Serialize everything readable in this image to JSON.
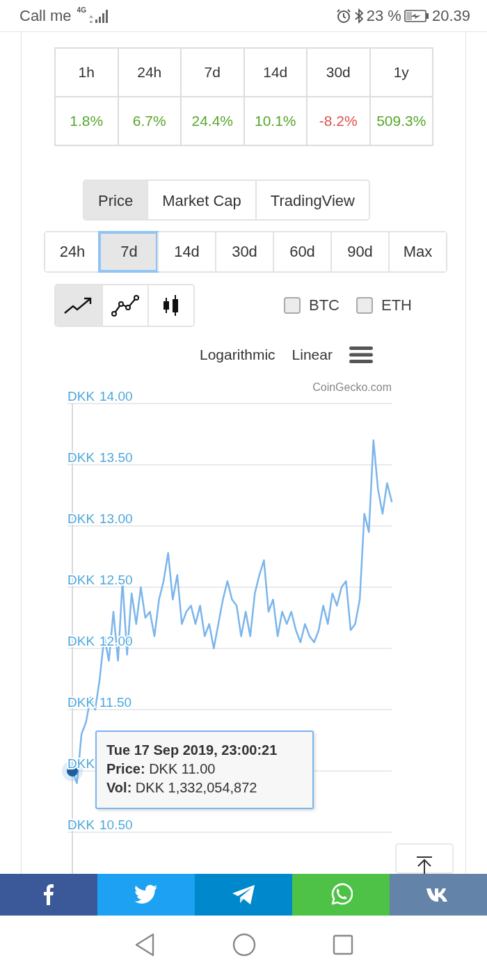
{
  "status_bar": {
    "carrier": "Call me",
    "network": "4G",
    "battery": "23 %",
    "time": "20.39"
  },
  "change_table": {
    "columns": [
      "1h",
      "24h",
      "7d",
      "14d",
      "30d",
      "1y"
    ],
    "values": [
      {
        "text": "1.8%",
        "color": "#58a62b"
      },
      {
        "text": "6.7%",
        "color": "#58a62b"
      },
      {
        "text": "24.4%",
        "color": "#58a62b"
      },
      {
        "text": "10.1%",
        "color": "#58a62b"
      },
      {
        "text": "-8.2%",
        "color": "#d9534f"
      },
      {
        "text": "509.3%",
        "color": "#58a62b"
      }
    ]
  },
  "chart_tabs": [
    {
      "label": "Price",
      "selected": true
    },
    {
      "label": "Market Cap",
      "selected": false
    },
    {
      "label": "TradingView",
      "selected": false
    }
  ],
  "ranges": [
    {
      "label": "24h",
      "selected": false
    },
    {
      "label": "7d",
      "selected": true
    },
    {
      "label": "14d",
      "selected": false
    },
    {
      "label": "30d",
      "selected": false
    },
    {
      "label": "60d",
      "selected": false
    },
    {
      "label": "90d",
      "selected": false
    },
    {
      "label": "Max",
      "selected": false
    }
  ],
  "chart_types": [
    {
      "kind": "line",
      "selected": true
    },
    {
      "kind": "markers",
      "selected": false
    },
    {
      "kind": "candle",
      "selected": false
    }
  ],
  "compare": [
    {
      "label": "BTC",
      "checked": false
    },
    {
      "label": "ETH",
      "checked": false
    }
  ],
  "scales": [
    "Logarithmic",
    "Linear"
  ],
  "chart": {
    "credit": "CoinGecko.com",
    "chart_data": {
      "type": "line",
      "ylabel": "DKK",
      "ylim": [
        10.16,
        14
      ],
      "grid": true,
      "yticks": [
        {
          "value": 14,
          "label": "14.00"
        },
        {
          "value": 13.5,
          "label": "13.50"
        },
        {
          "value": 13,
          "label": "13.00"
        },
        {
          "value": 12.5,
          "label": "12.50"
        },
        {
          "value": 12,
          "label": "12.00"
        },
        {
          "value": 11.5,
          "label": "11.50"
        },
        {
          "value": 10.5,
          "label": "10.50"
        }
      ],
      "series": [
        {
          "color": "#7cb5ec",
          "values": [
            11.0,
            10.9,
            11.3,
            11.4,
            11.6,
            11.5,
            11.75,
            12.1,
            11.9,
            12.3,
            11.9,
            12.55,
            11.95,
            12.45,
            12.2,
            12.5,
            12.25,
            12.3,
            12.1,
            12.4,
            12.55,
            12.78,
            12.4,
            12.6,
            12.2,
            12.3,
            12.35,
            12.2,
            12.35,
            12.1,
            12.2,
            12.0,
            12.2,
            12.4,
            12.55,
            12.4,
            12.35,
            12.1,
            12.3,
            12.1,
            12.45,
            12.6,
            12.72,
            12.3,
            12.4,
            12.1,
            12.3,
            12.2,
            12.3,
            12.15,
            12.05,
            12.2,
            12.1,
            12.05,
            12.15,
            12.35,
            12.2,
            12.45,
            12.35,
            12.5,
            12.55,
            12.15,
            12.2,
            12.4,
            13.1,
            12.95,
            13.7,
            13.3,
            13.1,
            13.35,
            13.2
          ]
        }
      ]
    },
    "tooltip": [
      "Tue 17 Sep 2019, 23:00:21",
      "**Price:** DKK 11.00",
      "**Vol:** DKK 1,332,054,872"
    ]
  },
  "share": [
    {
      "kind": "facebook",
      "color": "#3b5998"
    },
    {
      "kind": "twitter",
      "color": "#1da1f2"
    },
    {
      "kind": "telegram",
      "color": "#0088cc"
    },
    {
      "kind": "whatsapp",
      "color": "#4dc247"
    },
    {
      "kind": "vk",
      "color": "#6383a8"
    }
  ],
  "nav": [
    {
      "kind": "back"
    },
    {
      "kind": "home"
    },
    {
      "kind": "recents"
    }
  ]
}
